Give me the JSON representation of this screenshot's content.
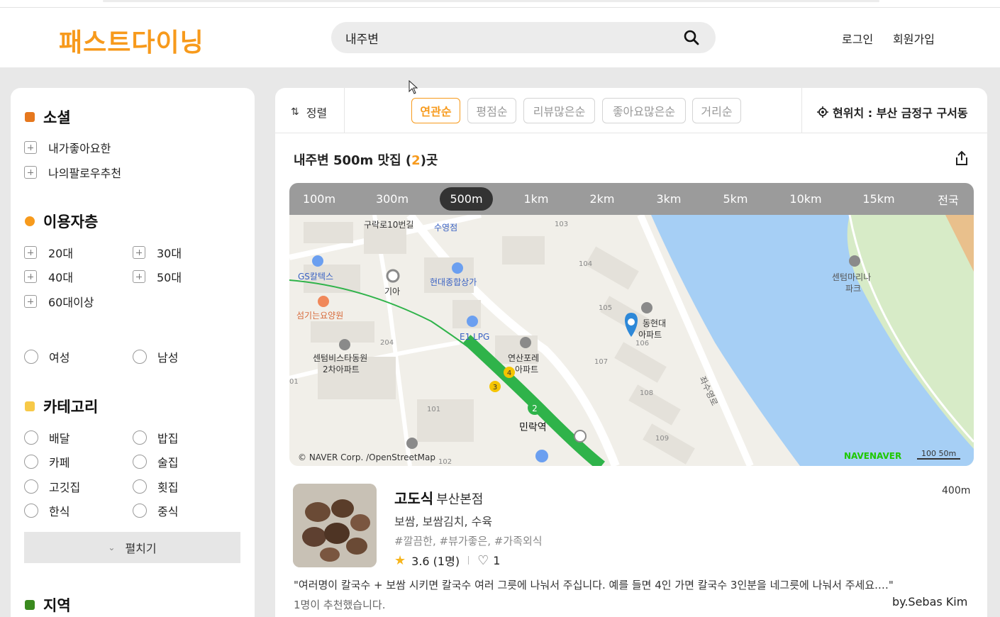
{
  "header": {
    "logo": "패스트다이닝",
    "search_value": "내주변",
    "login": "로그인",
    "signup": "회원가입"
  },
  "sidebar": {
    "social": {
      "title": "소셜",
      "color": "#e6781e",
      "items": [
        "내가좋아요한",
        "나의팔로우추천"
      ]
    },
    "age": {
      "title": "이용자층",
      "color": "#f79a1c",
      "items": [
        "20대",
        "30대",
        "40대",
        "50대",
        "60대이상"
      ],
      "gender": [
        "여성",
        "남성"
      ]
    },
    "category": {
      "title": "카테고리",
      "color": "#f7c948",
      "items": [
        "배달",
        "밥집",
        "카페",
        "술집",
        "고깃집",
        "횟집",
        "한식",
        "중식"
      ],
      "expand": "펼치기"
    },
    "region": {
      "title": "지역",
      "color": "#3a8a1e"
    }
  },
  "sort": {
    "label": "정렬",
    "options": [
      "연관순",
      "평점순",
      "리뷰많은순",
      "좋아요많은순",
      "거리순"
    ],
    "active": "연관순",
    "location": "현위치 : 부산 금정구 구서동"
  },
  "results": {
    "prefix": "내주변 500m 맛집 (",
    "count": "2",
    "suffix": ")곳"
  },
  "distances": [
    "100m",
    "300m",
    "500m",
    "1km",
    "2km",
    "3km",
    "5km",
    "10km",
    "15km",
    "전국"
  ],
  "active_distance": "500m",
  "map": {
    "labels": {
      "gs": "GS칼텍스",
      "kia": "기아",
      "hyundai_mall": "현대종합상가",
      "sumyungjum": "수영점",
      "guro": "구락로10번길",
      "nursing": "섬기는요양원",
      "e1": "E1 LPG",
      "centum_star": "센텀비스타동원",
      "centum_star2": "2차아파트",
      "yeonsan": "연산포레",
      "yeonsan2": "아파트",
      "minrak": "민락역",
      "dong_hyundai": "동현대",
      "dong_hyundai2": "아파트",
      "centum_marina": "센텀마리나",
      "centum_marina2": "파크",
      "road": "좌수영로",
      "b103": "103",
      "b104": "104",
      "b105": "105",
      "b106": "106",
      "b107": "107",
      "b108": "108",
      "b109": "109",
      "b101": "101",
      "b204": "204",
      "b102": "102",
      "b01": "01"
    },
    "copyright": "© NAVER Corp. /OpenStreetMap",
    "logo": "NAVENAVER",
    "scale": "100 50m"
  },
  "restaurant": {
    "name": "고도식",
    "branch": "부산본점",
    "distance": "400m",
    "menu": "보쌈, 보쌈김치, 수육",
    "tags": "#깔끔한, #뷰가좋은, #가족외식",
    "rating": "3.6 (1명)",
    "likes": "1",
    "review": "\"여러명이 칼국수 + 보쌈 시키면 칼국수 여러 그릇에 나눠서 주십니다. 예를 들면 4인 가면 칼국수 3인분을 네그릇에 나눠서 주세요.…\"",
    "recommended": "1명이 추천했습니다.",
    "author": "by.Sebas Kim"
  },
  "colors": {
    "brand": "#f79a1c",
    "water": "#a6cff5",
    "park": "#d7ebc7",
    "metro": "#2fb34a"
  }
}
